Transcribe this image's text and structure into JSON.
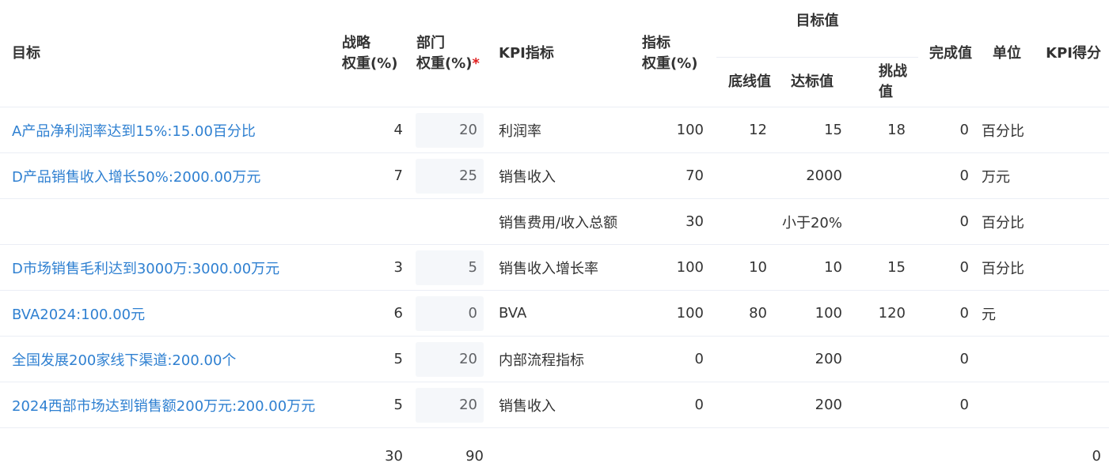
{
  "headers": {
    "goal": "目标",
    "strategy_weight": [
      "战略",
      "权重(%)"
    ],
    "dept_weight": [
      "部门",
      "权重(%)"
    ],
    "required_mark": "*",
    "kpi": "KPI指标",
    "index_weight": [
      "指标",
      "权重(%)"
    ],
    "target_group": "目标值",
    "baseline": "底线值",
    "standard": "达标值",
    "challenge": "挑战值",
    "completion": "完成值",
    "unit": "单位",
    "kpi_score": "KPI得分"
  },
  "rows": [
    {
      "goal": "A产品净利润率达到15%:15.00百分比",
      "strategy_weight": "4",
      "dept_weight": "20",
      "kpi": "利润率",
      "index_weight": "100",
      "baseline": "12",
      "standard": "15",
      "challenge": "18",
      "completion": "0",
      "unit": "百分比",
      "score": ""
    },
    {
      "goal": "D产品销售收入增长50%:2000.00万元",
      "strategy_weight": "7",
      "dept_weight": "25",
      "kpi": "销售收入",
      "index_weight": "70",
      "baseline": "",
      "standard": "2000",
      "challenge": "",
      "completion": "0",
      "unit": "万元",
      "score": ""
    },
    {
      "goal": "",
      "strategy_weight": "",
      "dept_weight": "",
      "kpi": "销售费用/收入总额",
      "index_weight": "30",
      "baseline": "",
      "standard": "小于20%",
      "challenge": "",
      "completion": "0",
      "unit": "百分比",
      "score": ""
    },
    {
      "goal": "D市场销售毛利达到3000万:3000.00万元",
      "strategy_weight": "3",
      "dept_weight": "5",
      "kpi": "销售收入增长率",
      "index_weight": "100",
      "baseline": "10",
      "standard": "10",
      "challenge": "15",
      "completion": "0",
      "unit": "百分比",
      "score": ""
    },
    {
      "goal": "BVA2024:100.00元",
      "strategy_weight": "6",
      "dept_weight": "0",
      "kpi": "BVA",
      "index_weight": "100",
      "baseline": "80",
      "standard": "100",
      "challenge": "120",
      "completion": "0",
      "unit": "元",
      "score": ""
    },
    {
      "goal": "全国发展200家线下渠道:200.00个",
      "strategy_weight": "5",
      "dept_weight": "20",
      "kpi": "内部流程指标",
      "index_weight": "0",
      "baseline": "",
      "standard": "200",
      "challenge": "",
      "completion": "0",
      "unit": "",
      "score": ""
    },
    {
      "goal": "2024西部市场达到销售额200万元:200.00万元",
      "strategy_weight": "5",
      "dept_weight": "20",
      "kpi": "销售收入",
      "index_weight": "0",
      "baseline": "",
      "standard": "200",
      "challenge": "",
      "completion": "0",
      "unit": "",
      "score": ""
    }
  ],
  "totals": {
    "strategy_weight": "30",
    "dept_weight": "90",
    "score": "0"
  }
}
